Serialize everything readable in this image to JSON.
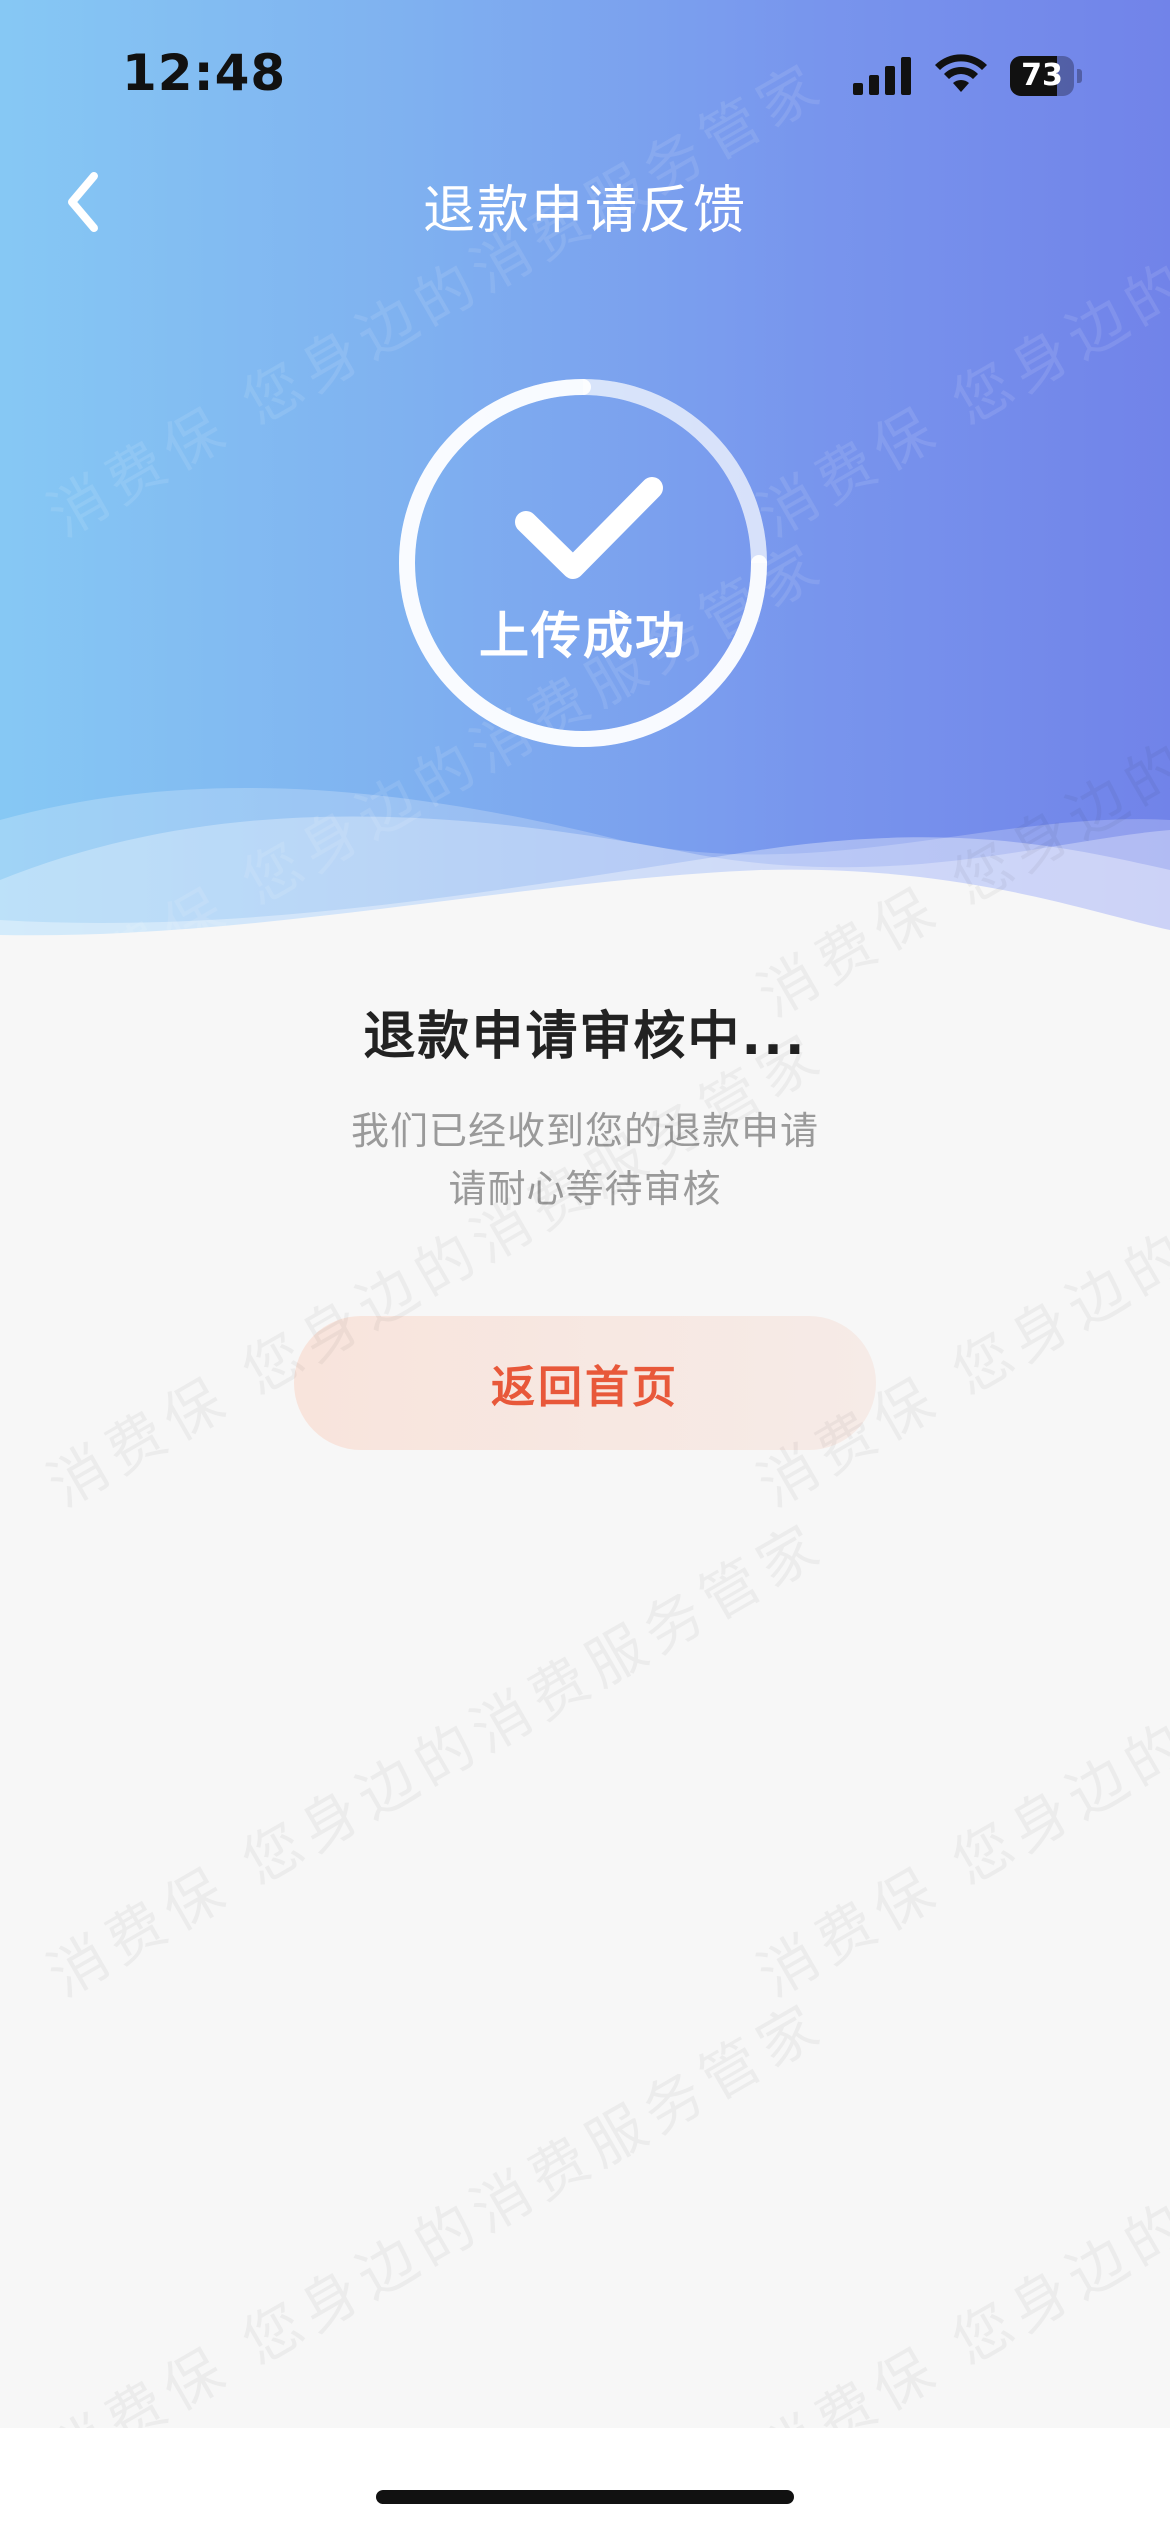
{
  "status_bar": {
    "time": "12:48",
    "battery_level": "73",
    "battery_fraction": 0.73,
    "icons": [
      "signal-icon",
      "wifi-icon",
      "battery-icon"
    ]
  },
  "nav": {
    "back_icon": "chevron-left-icon",
    "title": "退款申请反馈"
  },
  "result": {
    "icon": "check-icon",
    "badge_label": "上传成功",
    "title": "退款申请审核中...",
    "desc_line1": "我们已经收到您的退款申请",
    "desc_line2": "请耐心等待审核"
  },
  "actions": {
    "home_button_label": "返回首页"
  },
  "watermark": {
    "line_a": "消费保 您身边的消费服务管家",
    "line_b": "消费保 您身边的消费服务管家"
  },
  "colors": {
    "hero_gradient_start": "#86c8f4",
    "hero_gradient_end": "#7183e9",
    "button_text": "#e8583a",
    "button_bg": "#f8e4dc",
    "title_text": "#222222",
    "desc_text": "#9a9a9a"
  }
}
